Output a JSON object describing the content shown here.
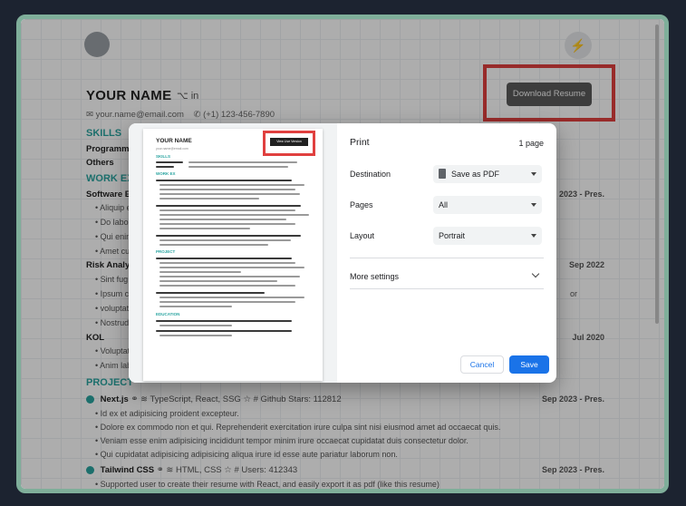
{
  "resume": {
    "name": "YOUR NAME",
    "email": "your.name@email.com",
    "phone": "(+1) 123-456-7890",
    "download_label": "Download Resume",
    "skills_heading": "SKILLS",
    "skills_rows": [
      "Programmi",
      "Others"
    ],
    "work_heading": "WORK EX",
    "work": [
      {
        "title": "Software E",
        "date": "2023 - Pres."
      },
      {
        "title": "Risk Analys",
        "date": "Sep 2022"
      },
      {
        "title": "KOL",
        "date": "Jul 2020"
      }
    ],
    "bullets_1": [
      "Aliquip e",
      "Do labor",
      "Qui enim",
      "Amet cul"
    ],
    "bullets_2": [
      "Sint fug",
      "Ipsum cu",
      "voluptate",
      "Nostrud c"
    ],
    "bullets_3": [
      "Voluptate",
      "Anim lab"
    ],
    "bullets_2_tail": "or",
    "projects_heading": "PROJECT",
    "project_1": {
      "name": "Next.js",
      "tech": "TypeScript, React, SSG",
      "stat": "# Github Stars: 112812",
      "date": "Sep 2023 - Pres."
    },
    "project_1_bullets": [
      "Id ex et adipisicing proident excepteur.",
      "Dolore ex commodo non et qui. Reprehenderit exercitation irure culpa sint nisi eiusmod amet ad occaecat quis.",
      "Veniam esse enim adipisicing incididunt tempor minim irure occaecat cupidatat duis consectetur dolor.",
      "Qui cupidatat adipisicing adipisicing aliqua irure id esse aute pariatur laborum non."
    ],
    "project_2": {
      "name": "Tailwind CSS",
      "tech": "HTML, CSS",
      "stat": "# Users: 412343",
      "date": "Sep 2023 - Pres."
    },
    "project_2_bullets": [
      "Supported user to create their resume with React, and easily export it as pdf (like this resume)"
    ]
  },
  "print_dialog": {
    "title": "Print",
    "page_count": "1 page",
    "destination_label": "Destination",
    "destination_value": "Save as PDF",
    "pages_label": "Pages",
    "pages_value": "All",
    "layout_label": "Layout",
    "layout_value": "Portrait",
    "more_settings": "More settings",
    "cancel": "Cancel",
    "save": "Save",
    "preview": {
      "name": "YOUR NAME",
      "download_label": "View Live Version"
    }
  },
  "colors": {
    "accent": "#2aa4a0",
    "highlight": "#e0403f",
    "primary_button": "#1a73e8"
  }
}
